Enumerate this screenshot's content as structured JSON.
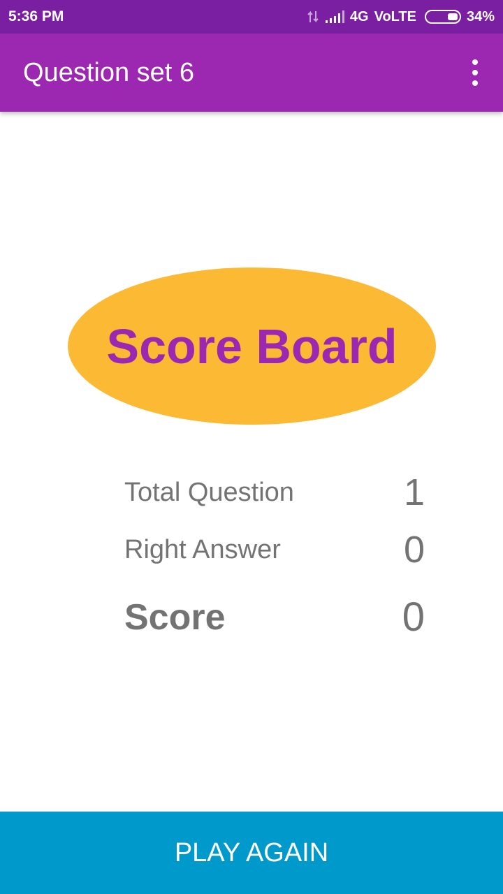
{
  "status_bar": {
    "time": "5:36 PM",
    "network": "4G",
    "volte": "VoLTE",
    "battery": "34%",
    "battery_level": 0.34
  },
  "app_bar": {
    "title": "Question set 6",
    "overflow_icon": "more-vert-icon"
  },
  "score_board": {
    "title": "Score Board",
    "title_color": "#9c27b0",
    "badge_color": "#fbb934"
  },
  "results": {
    "total_question_label": "Total Question",
    "total_question_value": "1",
    "right_answer_label": "Right Answer",
    "right_answer_value": "0",
    "score_label": "Score",
    "score_value": "0"
  },
  "actions": {
    "play_again_label": "PLAY AGAIN",
    "play_again_color": "#0099cc"
  },
  "colors": {
    "status_bar": "#7b1fa2",
    "app_bar": "#9c27b0",
    "text_gray": "#737373"
  }
}
